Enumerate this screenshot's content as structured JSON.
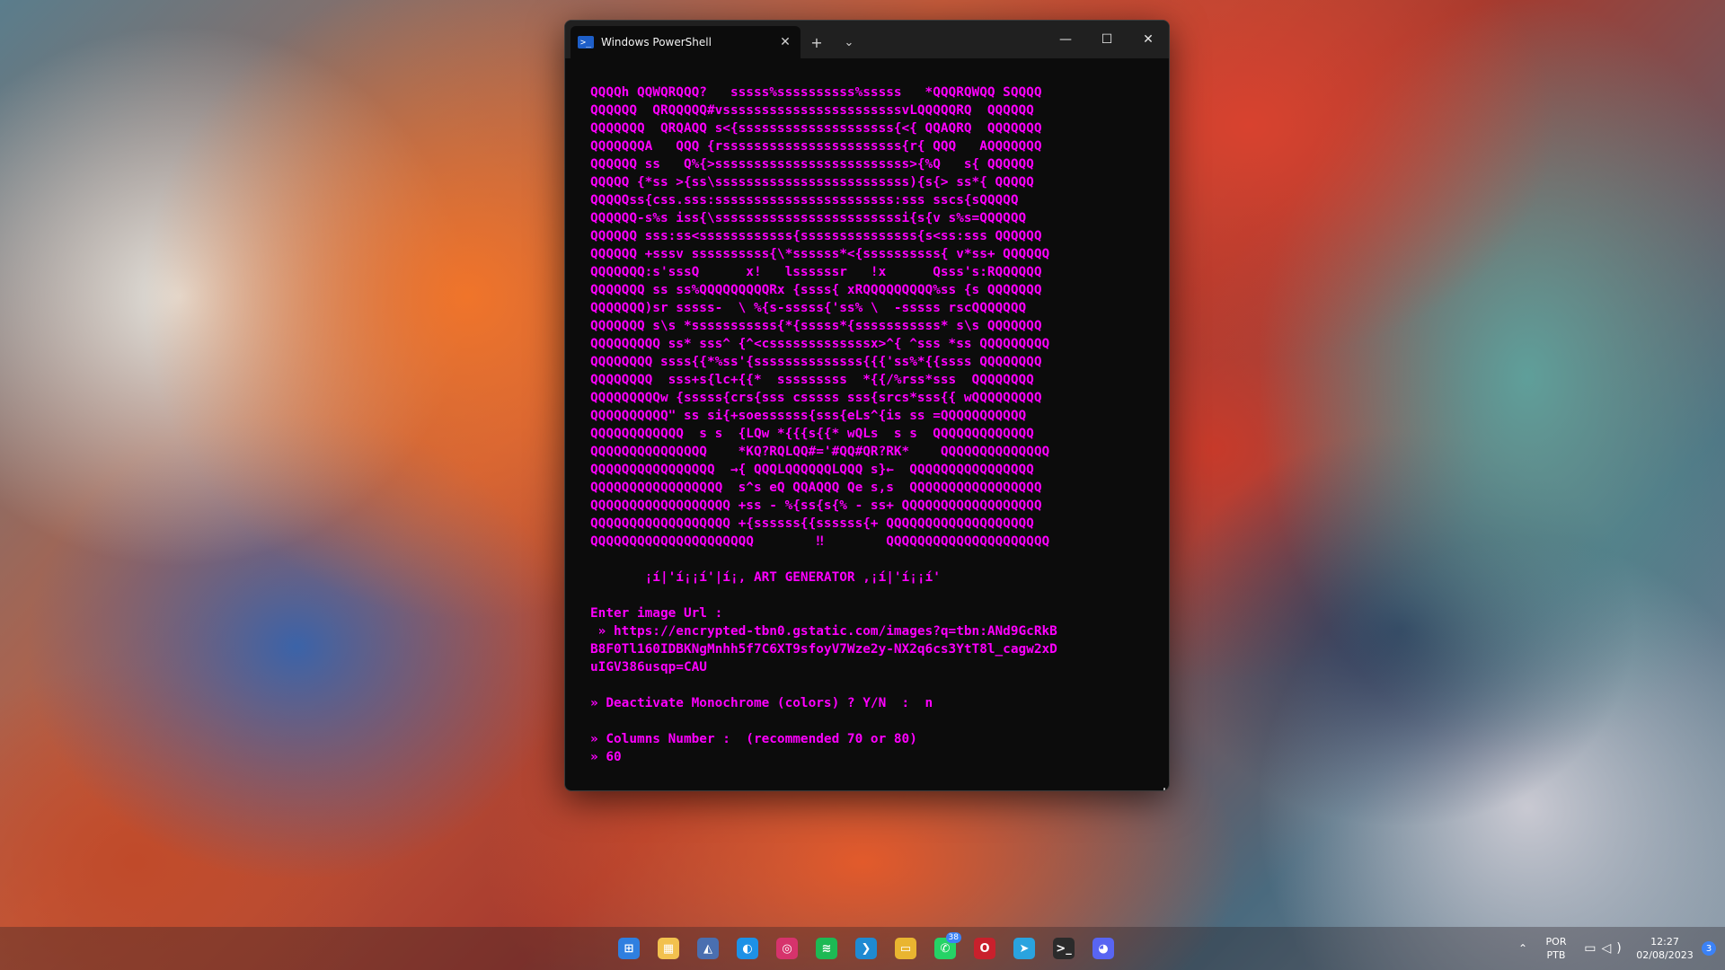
{
  "window": {
    "tab_title": "Windows PowerShell",
    "tab_icon": "powershell-icon",
    "new_tab": "+",
    "dropdown": "⌄",
    "tab_close": "✕",
    "minimize": "—",
    "maximize": "☐",
    "close": "✕"
  },
  "terminal": {
    "output": "QQQQh QQWQRQQQ?   sssss%ssssssssss%sssss   *QQQRQWQQ SQQQQ\nQQQQQQ  QRQQQQQ#vsssssssssssssssssssssssvLQQQQQRQ  QQQQQQ\nQQQQQQQ  QRQAQQ s<{ssssssssssssssssssss{<{ QQAQRQ  QQQQQQQ\nQQQQQQQA   QQQ {rsssssssssssssssssssssss{r{ QQQ   AQQQQQQQ\nQQQQQQ ss   Q%{>sssssssssssssssssssssssss>{%Q   s{ QQQQQQ\nQQQQQ {*ss >{ss\\sssssssssssssssssssssssss){s{> ss*{ QQQQQ\nQQQQQss{css.sss:sssssssssssssssssssssss:sss sscs{sQQQQQ\nQQQQQQ-s%s iss{\\ssssssssssssssssssssssssi{s{v s%s=QQQQQQ\nQQQQQQ sss:ss<ssssssssssss{sssssssssssssss{s<ss:sss QQQQQQ\nQQQQQQ +sssv ssssssssss{\\*ssssss*<{ssssssssss{ v*ss+ QQQQQQ\nQQQQQQQ:s'sssQ      x!   lssssssr   !x      Qsss's:RQQQQQQ\nQQQQQQQ ss ss%QQQQQQQQQRx {ssss{ xRQQQQQQQQQ%ss {s QQQQQQQ\nQQQQQQQ)sr sssss-  \\ %{s-sssss{'ss% \\  -sssss rscQQQQQQQ\nQQQQQQQ s\\s *sssssssssss{*{sssss*{sssssssssss* s\\s QQQQQQQ\nQQQQQQQQQ ss* sss^ {^<csssssssssssssx>^{ ^sss *ss QQQQQQQQQ\nQQQQQQQQ ssss{{*%ss'{ssssssssssssss{{{'ss%*{{ssss QQQQQQQQ\nQQQQQQQQ  sss+s{lc+{{*  sssssssss  *{{/%rss*sss  QQQQQQQQ\nQQQQQQQQQw {sssss{crs{sss csssss sss{srcs*sss{{ wQQQQQQQQQ\nQQQQQQQQQQ\" ss si{+soessssss{sss{eLs^{is ss =QQQQQQQQQQQ\nQQQQQQQQQQQQ  s s  {LQw *{{{s{{* wQLs  s s  QQQQQQQQQQQQQ\nQQQQQQQQQQQQQQQ    *KQ?RQLQQ#='#QQ#QR?RK*    QQQQQQQQQQQQQQ\nQQQQQQQQQQQQQQQQ  →{ QQQLQQQQQQLQQQ s}←  QQQQQQQQQQQQQQQQ\nQQQQQQQQQQQQQQQQQ  s^s eQ QQAQQQ Qe s,s  QQQQQQQQQQQQQQQQQ\nQQQQQQQQQQQQQQQQQQ +ss - %{ss{s{% - ss+ QQQQQQQQQQQQQQQQQQ\nQQQQQQQQQQQQQQQQQQ +{ssssss{{ssssss{+ QQQQQQQQQQQQQQQQQQQ\nQQQQQQQQQQQQQQQQQQQQQ        ‼        QQQQQQQQQQQQQQQQQQQQQ\n\n       ¡í|'í¡¡í'|í¡, ART GENERATOR ,¡í|'í¡¡í'\n\nEnter image Url :\n » https://encrypted-tbn0.gstatic.com/images?q=tbn:ANd9GcRkB\nB8F0Tl160IDBKNgMnhh5f7C6XT9sfoyV7Wze2y-NX2q6cs3YtT8l_cagw2xD\nuIGV386usqp=CAU\n\n» Deactivate Monochrome (colors) ? Y/N  :  n\n\n» Columns Number :  (recommended 70 or 80)\n» 60"
  },
  "taskbar": {
    "apps": [
      {
        "name": "start-icon",
        "glyph": "⊞",
        "color": "#2f7fe0"
      },
      {
        "name": "microsoft-store-icon",
        "glyph": "▦",
        "color": "#f2c14e"
      },
      {
        "name": "photos-icon",
        "glyph": "◭",
        "color": "#4a6fb0"
      },
      {
        "name": "docker-icon",
        "glyph": "◐",
        "color": "#1d91e6"
      },
      {
        "name": "instagram-icon",
        "glyph": "◎",
        "color": "#d6336c"
      },
      {
        "name": "spotify-icon",
        "glyph": "≋",
        "color": "#1db954"
      },
      {
        "name": "vscode-icon",
        "glyph": "❯",
        "color": "#1f8ad2"
      },
      {
        "name": "file-explorer-icon",
        "glyph": "▭",
        "color": "#e9b530"
      },
      {
        "name": "whatsapp-icon",
        "glyph": "✆",
        "color": "#25d366",
        "badge": "38"
      },
      {
        "name": "opera-icon",
        "glyph": "O",
        "color": "#c9202c"
      },
      {
        "name": "telegram-icon",
        "glyph": "➤",
        "color": "#2aa3df"
      },
      {
        "name": "terminal-icon",
        "glyph": ">_",
        "color": "#2b2b2b"
      },
      {
        "name": "discord-icon",
        "glyph": "◕",
        "color": "#5865f2"
      }
    ],
    "tray": {
      "chevron": "⌃",
      "lang_line1": "POR",
      "lang_line2": "PTB",
      "time": "12:27",
      "date": "02/08/2023",
      "notifications": "3"
    }
  }
}
